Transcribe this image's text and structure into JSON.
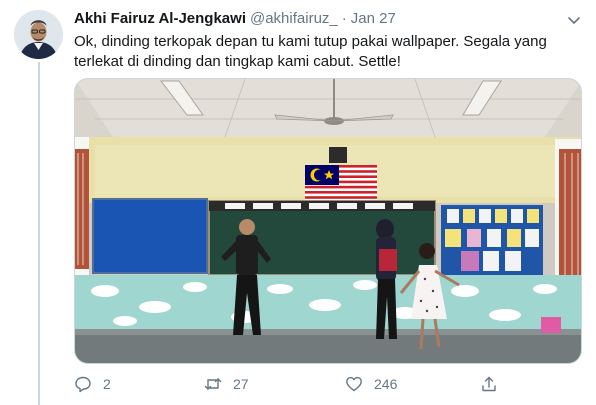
{
  "tweet": {
    "author_name": "Akhi Fairuz Al-Jengkawi",
    "handle": "@akhifairuz_",
    "separator": "·",
    "date": "Jan 27",
    "text": "Ok, dinding terkopak depan tu kami tutup pakai wallpaper. Segala yang terlekat di dinding dan tingkap kami cabut. Settle!",
    "avatar_icon": "avatar-photo",
    "menu_icon": "chevron-down-icon",
    "media_description_icon": "classroom-photo"
  },
  "actions": {
    "reply_count": "2",
    "retweet_count": "27",
    "like_count": "246",
    "reply_icon": "reply-icon",
    "retweet_icon": "retweet-icon",
    "like_icon": "heart-icon",
    "share_icon": "share-icon"
  },
  "colors": {
    "text_primary": "#14171a",
    "text_secondary": "#657786",
    "border": "#ccd6dd"
  }
}
